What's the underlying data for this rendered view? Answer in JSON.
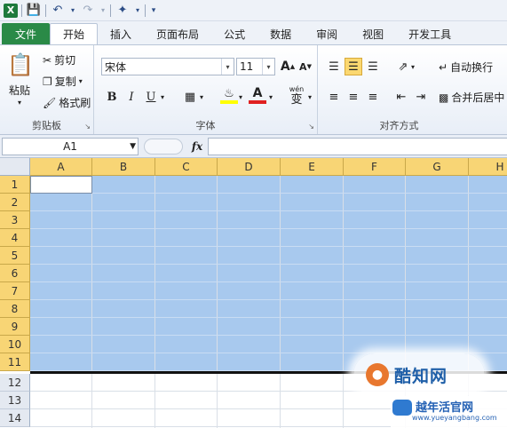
{
  "qat": {
    "app_icon": "X"
  },
  "tabs": [
    {
      "label": "文件"
    },
    {
      "label": "开始"
    },
    {
      "label": "插入"
    },
    {
      "label": "页面布局"
    },
    {
      "label": "公式"
    },
    {
      "label": "数据"
    },
    {
      "label": "审阅"
    },
    {
      "label": "视图"
    },
    {
      "label": "开发工具"
    }
  ],
  "clipboard": {
    "paste": "粘贴",
    "cut": "剪切",
    "copy": "复制",
    "format_painter": "格式刷",
    "label": "剪贴板"
  },
  "font": {
    "name": "宋体",
    "size": "11",
    "grow": "A",
    "shrink": "A",
    "bold": "B",
    "italic": "I",
    "underline": "U",
    "font_color": "A",
    "phonetic": "wén",
    "phonetic_char": "变",
    "label": "字体"
  },
  "alignment": {
    "wrap_text": "自动换行",
    "merge_center": "合并后居中",
    "label": "对齐方式"
  },
  "formula_bar": {
    "name_box": "A1",
    "fx": "fx",
    "value": ""
  },
  "grid": {
    "columns": [
      "A",
      "B",
      "C",
      "D",
      "E",
      "F",
      "G",
      "H"
    ],
    "rows": [
      "1",
      "2",
      "3",
      "4",
      "5",
      "6",
      "7",
      "8",
      "9",
      "10",
      "11",
      "12",
      "13",
      "14"
    ],
    "selected_rows": 11
  },
  "watermark": {
    "logo_text": "酷知网",
    "site_name": "越年活官网",
    "site_url": "www.yueyangbang.com"
  },
  "colors": {
    "file_tab": "#2a8a47",
    "selection": "#a8c9ee",
    "header_highlight": "#f8d575"
  }
}
